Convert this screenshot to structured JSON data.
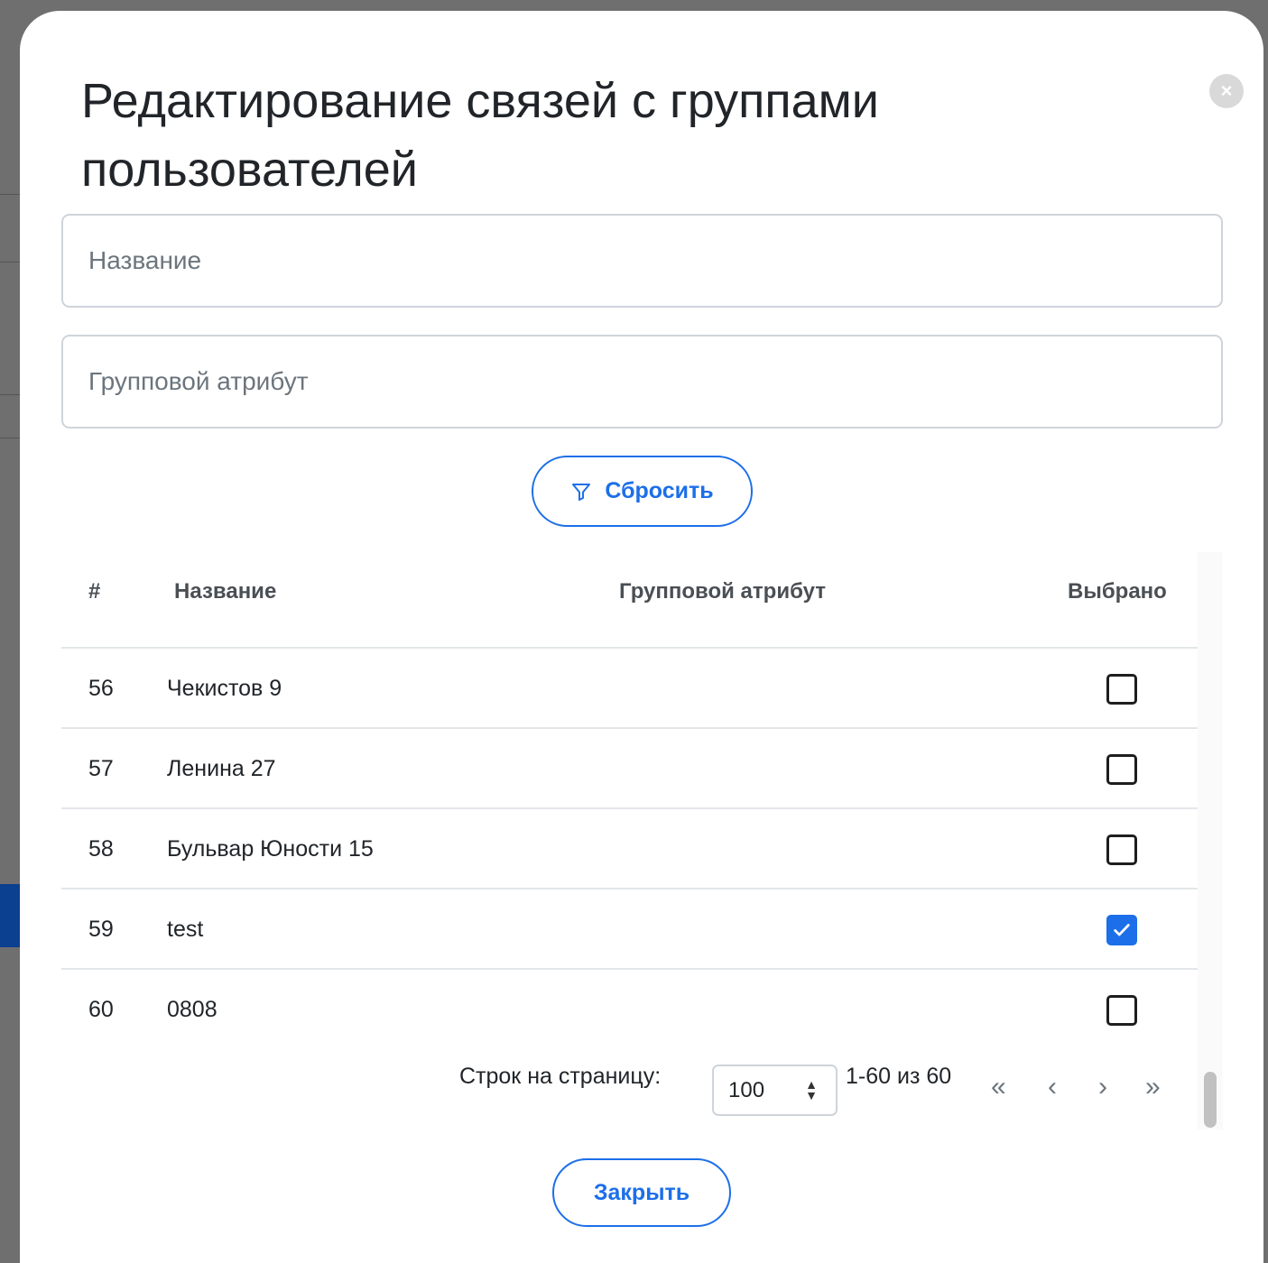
{
  "modal": {
    "title": "Редактирование связей с группами пользователей",
    "close_icon": "×"
  },
  "filters": {
    "name_placeholder": "Название",
    "attribute_placeholder": "Групповой атрибут",
    "reset_label": "Сбросить",
    "reset_icon": "filter-icon"
  },
  "table": {
    "columns": [
      "#",
      "Название",
      "Групповой атрибут",
      "Выбрано"
    ],
    "rows": [
      {
        "num": "56",
        "name": "Чекистов 9",
        "attribute": "",
        "selected": false
      },
      {
        "num": "57",
        "name": "Ленина 27",
        "attribute": "",
        "selected": false
      },
      {
        "num": "58",
        "name": "Бульвар Юности 15",
        "attribute": "",
        "selected": false
      },
      {
        "num": "59",
        "name": "test",
        "attribute": "",
        "selected": true
      },
      {
        "num": "60",
        "name": "0808",
        "attribute": "",
        "selected": false
      }
    ]
  },
  "pagination": {
    "rows_per_page_label": "Строк на страницу:",
    "rows_per_page_value": "100",
    "range_text": "1-60 из 60",
    "first_icon": "«",
    "prev_icon": "‹",
    "next_icon": "›",
    "last_icon": "»"
  },
  "footer": {
    "close_label": "Закрыть"
  },
  "colors": {
    "accent": "#1c6fe8",
    "text": "#212529",
    "muted": "#6c757d"
  }
}
